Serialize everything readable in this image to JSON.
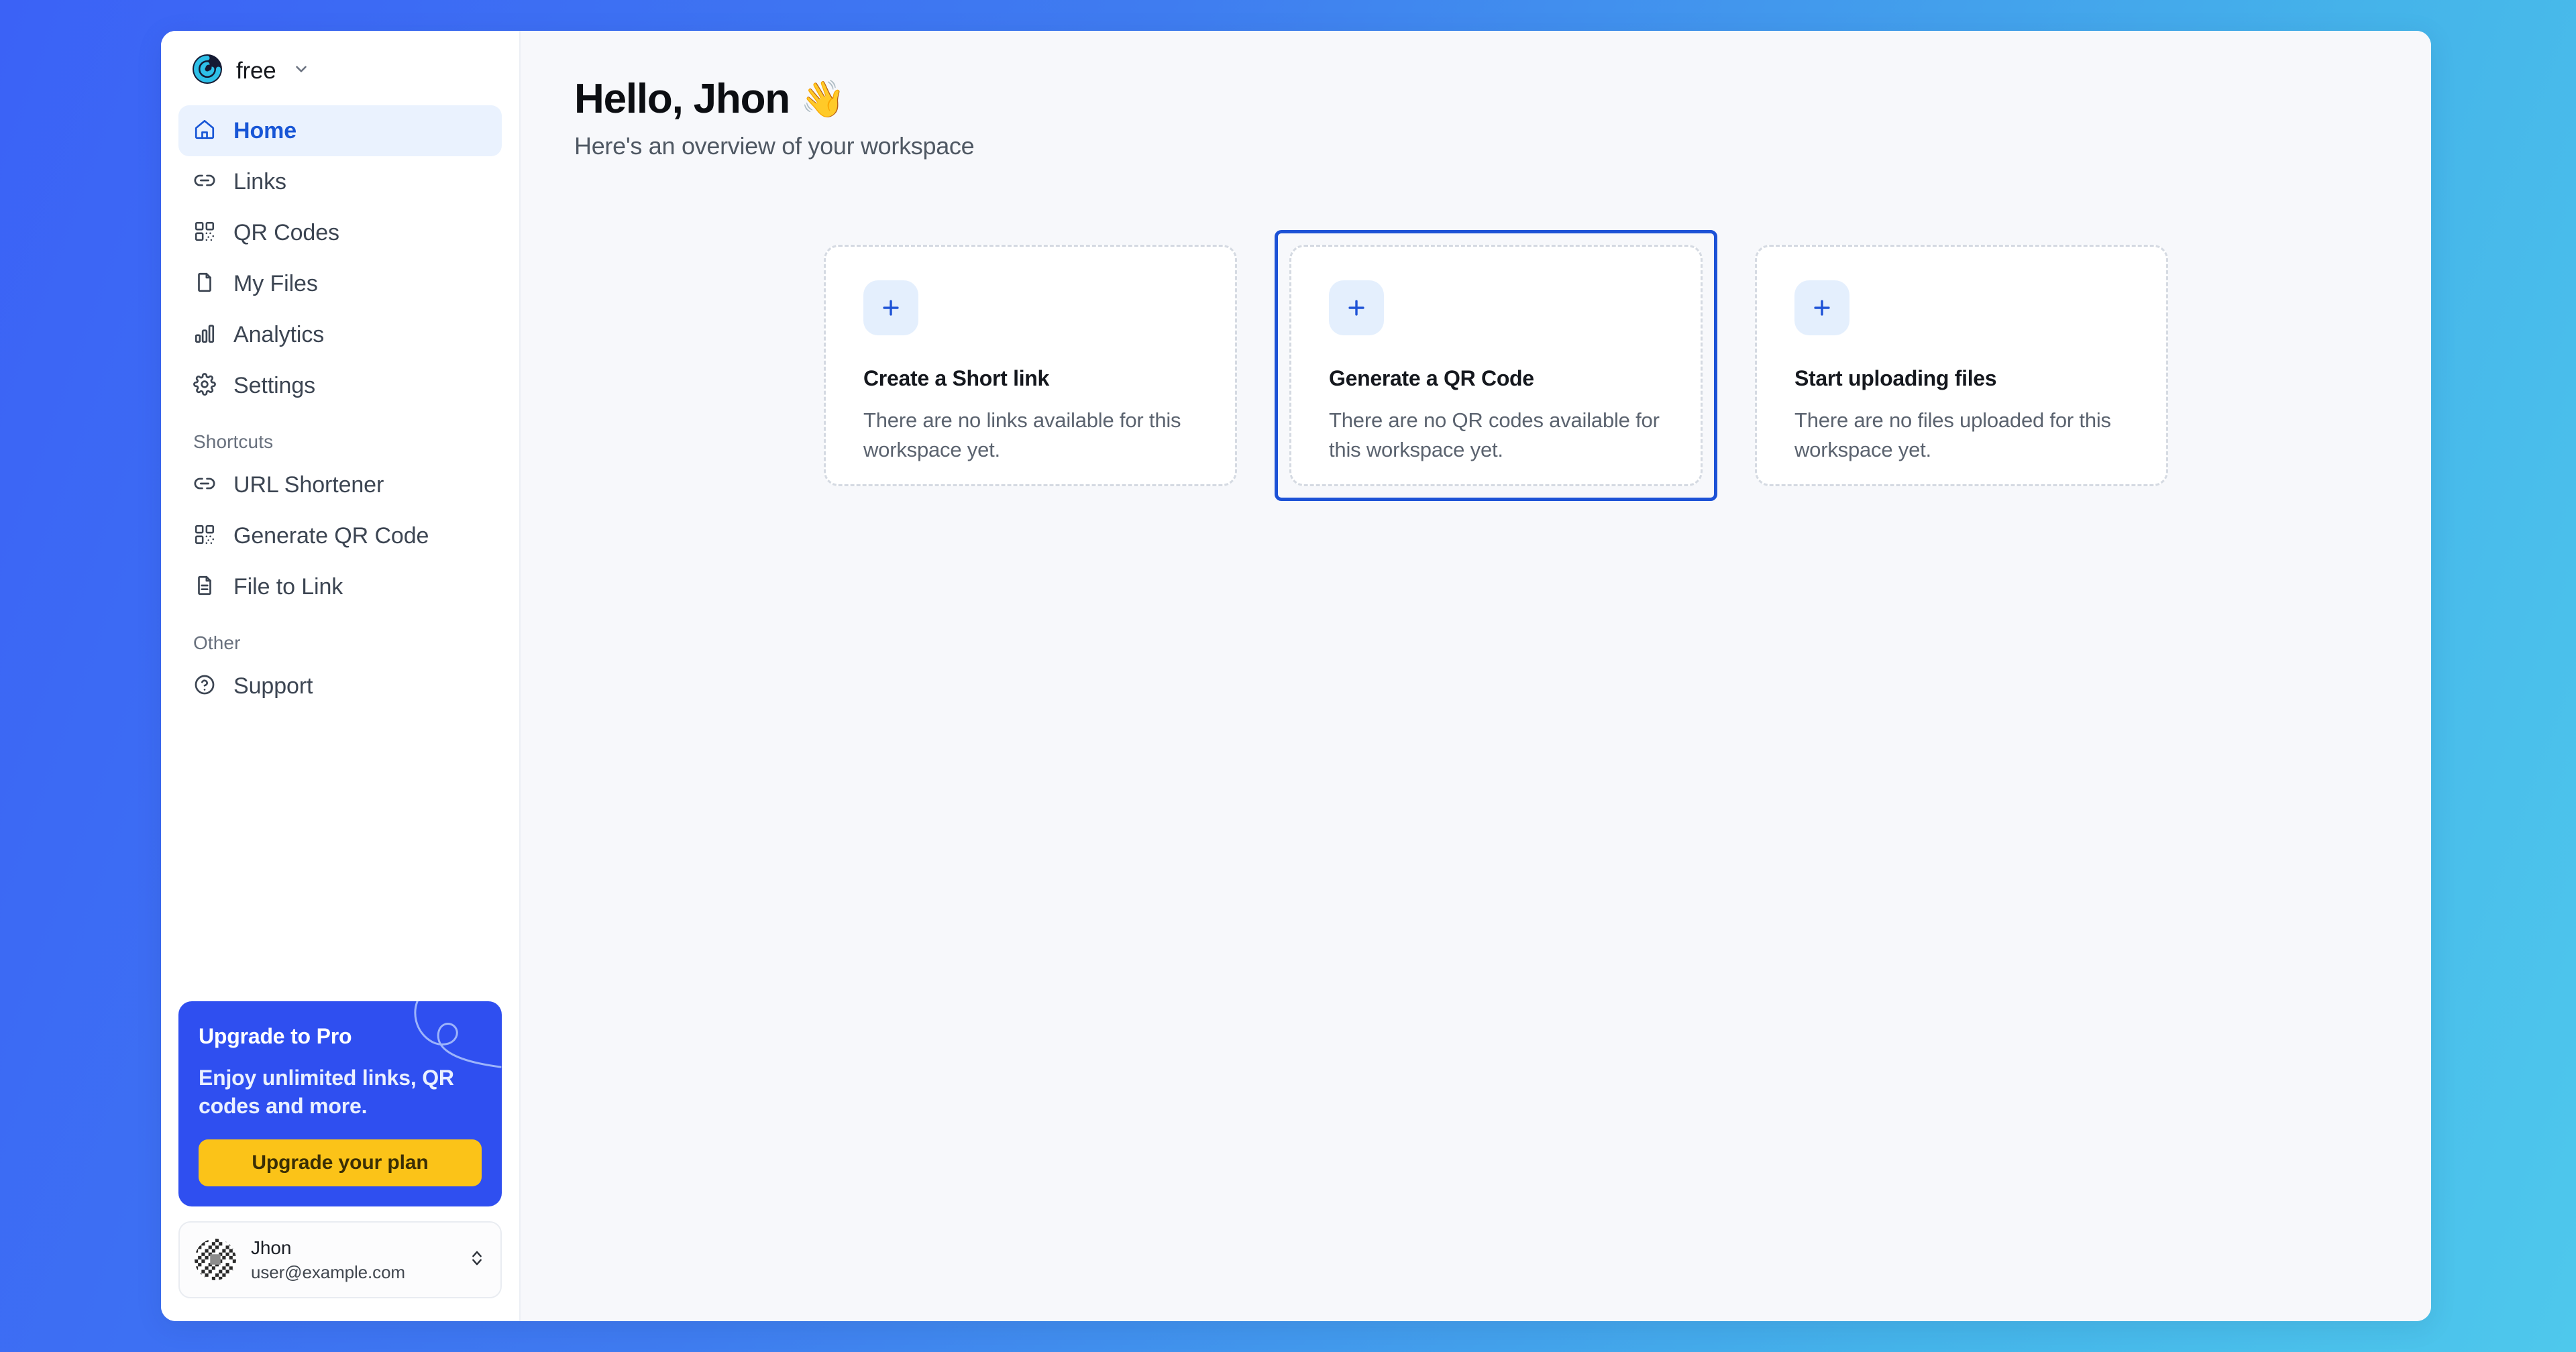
{
  "workspace": {
    "name": "free",
    "logo_icon": "app-logo-icon",
    "chevron_icon": "chevron-down-icon"
  },
  "sidebar": {
    "nav": [
      {
        "label": "Home",
        "icon": "home-icon",
        "active": true
      },
      {
        "label": "Links",
        "icon": "link-icon",
        "active": false
      },
      {
        "label": "QR Codes",
        "icon": "qr-code-icon",
        "active": false
      },
      {
        "label": "My Files",
        "icon": "file-icon",
        "active": false
      },
      {
        "label": "Analytics",
        "icon": "bar-chart-icon",
        "active": false
      },
      {
        "label": "Settings",
        "icon": "gear-icon",
        "active": false
      }
    ],
    "shortcuts_heading": "Shortcuts",
    "shortcuts": [
      {
        "label": "URL Shortener",
        "icon": "link-icon"
      },
      {
        "label": "Generate QR Code",
        "icon": "qr-code-icon"
      },
      {
        "label": "File to Link",
        "icon": "document-icon"
      }
    ],
    "other_heading": "Other",
    "other": [
      {
        "label": "Support",
        "icon": "help-circle-icon"
      }
    ],
    "upgrade": {
      "title": "Upgrade to Pro",
      "subtitle": "Enjoy unlimited links, QR codes and more.",
      "button_label": "Upgrade your plan",
      "background_color": "#2f4ff0",
      "button_color": "#fbc318"
    },
    "user": {
      "name": "Jhon",
      "email": "user@example.com",
      "avatar_icon": "identicon-avatar",
      "expand_icon": "chevrons-up-down-icon"
    }
  },
  "main": {
    "greeting": "Hello, Jhon",
    "greeting_emoji": "👋",
    "subtitle": "Here's an overview of your workspace",
    "cards": [
      {
        "title": "Create a Short link",
        "description": "There are no links available for this workspace yet.",
        "icon": "plus-icon",
        "focused": false
      },
      {
        "title": "Generate a QR Code",
        "description": "There are no QR codes available for this workspace yet.",
        "icon": "plus-icon",
        "focused": true
      },
      {
        "title": "Start uploading files",
        "description": "There are no files uploaded for this workspace yet.",
        "icon": "plus-icon",
        "focused": false
      }
    ]
  },
  "theme": {
    "accent": "#1d52d6",
    "active_nav_bg": "#eaf2fe",
    "page_bg_from": "#3b62f6",
    "page_bg_to": "#4ec8ec"
  }
}
